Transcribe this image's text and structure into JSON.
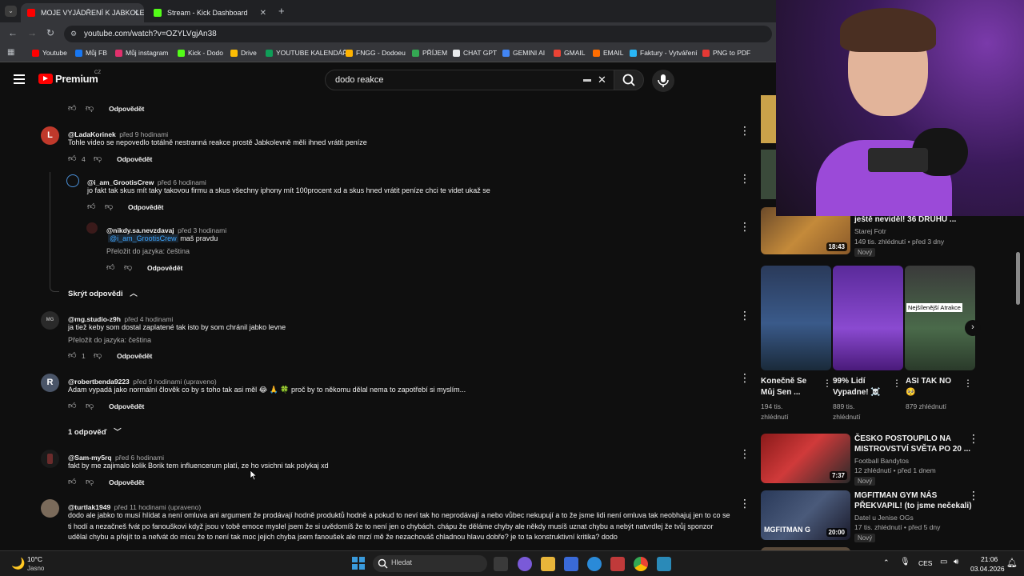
{
  "browser": {
    "tabs": [
      {
        "title": "MOJE VYJÁDŘENÍ K JABKOLEVN",
        "color": "#ff0000"
      },
      {
        "title": "Stream - Kick Dashboard",
        "color": "#53fc18"
      }
    ],
    "new_tab": "+",
    "url": "youtube.com/watch?v=OZYLVgjAn38",
    "bookmarks": [
      {
        "label": "Youtube",
        "color": "#ff0000"
      },
      {
        "label": "Můj FB",
        "color": "#1877f2"
      },
      {
        "label": "Můj instagram",
        "color": "#e1306c"
      },
      {
        "label": "Kick - Dodo",
        "color": "#53fc18"
      },
      {
        "label": "Drive",
        "color": "#fbbc04"
      },
      {
        "label": "YOUTUBE KALENDÁŘ",
        "color": "#0f9d58"
      },
      {
        "label": "FNGG - Dodoeu",
        "color": "#ffb300"
      },
      {
        "label": "PŘÍJEM",
        "color": "#34a853"
      },
      {
        "label": "CHAT GPT",
        "color": "#e8eaed"
      },
      {
        "label": "GEMINI AI",
        "color": "#4285f4"
      },
      {
        "label": "GMAIL",
        "color": "#ea4335"
      },
      {
        "label": "EMAIL",
        "color": "#ff6d00"
      },
      {
        "label": "Faktury - Vytváření",
        "color": "#29b6f6"
      },
      {
        "label": "PNG to PDF",
        "color": "#e53935"
      }
    ]
  },
  "youtube": {
    "logo": "Premium",
    "region": "CZ",
    "search_query": "dodo reakce"
  },
  "comments": [
    {
      "reply_label": "Odpovědět"
    },
    {
      "user": "@LadaKorinek",
      "time": "před 9 hodinami",
      "text": "Tohle video se nepovedlo totálně nestranná reakce prostě Jabkolevně měli ihned vrátit peníze",
      "likes": "4",
      "reply_label": "Odpovědět",
      "avatar_letter": "L",
      "avatar_color": "#c0392b"
    },
    {
      "user": "@i_am_GrootisCrew",
      "time": "před 6 hodinami",
      "text": "jo fakt tak skus mít taky takovou firmu a skus všechny iphony mít 100procent xd a skus hned vrátit peníze chci te videt ukaž se",
      "reply_label": "Odpovědět"
    },
    {
      "user": "@nikdy.sa.nevzdavaj",
      "time": "před 3 hodinami",
      "mention": "@i_am_GrootisCrew",
      "text": "maš pravdu",
      "translate": "Přeložit do jazyka: čeština",
      "reply_label": "Odpovědět"
    },
    {
      "hide_replies": "Skrýt odpovědi"
    },
    {
      "user": "@mg.studio-z9h",
      "time": "před 4 hodinami",
      "text": "ja tiež keby som dostal zaplatené tak isto by som chránil jabko levne",
      "translate": "Přeložit do jazyka: čeština",
      "likes": "1",
      "reply_label": "Odpovědět",
      "avatar_letter": "MG"
    },
    {
      "user": "@robertbenda9223",
      "time": "před 9 hodinami (upraveno)",
      "text": "Adam vypadá jako normální člověk co by s toho tak asi měl 😂 🙏 🍀  proč by to někomu dělal nema to zapotřebí si myslím...",
      "reply_label": "Odpovědět",
      "avatar_letter": "R",
      "avatar_color": "#4a5568"
    },
    {
      "replies_count": "1 odpověď"
    },
    {
      "user": "@Sam-my5rq",
      "time": "před 6 hodinami",
      "text": "fakt by me zajimalo kolik Borik tem influencerum platí, ze ho vsichni tak polykaj xd",
      "reply_label": "Odpovědět"
    },
    {
      "user": "@turtlak1949",
      "time": "před 11 hodinami (upraveno)",
      "lines": [
        "dodo ale jabko to musí hlídat a není omluva ani argument že prodávají hodně produktů hodně a pokud to neví tak ho neprodávají a nebo vůbec nekupují a to že jsme lidi není omluva tak neobhajuj  jen to co se",
        "ti hodí a nezačneš fvát po fanouškovi když jsou v tobě emoce myslel jsem že si uvědomíš že to není jen o chybách. chápu že děláme chyby ale někdy musíš uznat chybu a nebýt natvrdlej že tvůj sponzor",
        "udělal chybu a přejít to a nefvát do micu že to není tak moc jejich chyba jsem fanoušek ale mrzí mě že nezachováš chladnou hlavu dobře? je to ta konstruktivní kritika? dodo"
      ]
    }
  ],
  "sidebar": {
    "top_video": {
      "title": "ještě neviděl! 36 DRUHU ...",
      "channel": "Starej Fotr",
      "meta": "149 tis. zhlédnutí • před 3 dny",
      "badge": "Nový",
      "duration": "18:43"
    },
    "shorts": [
      {
        "title_l1": "Konečně Se",
        "title_l2": "Můj Sen ...",
        "meta_l1": "194 tis.",
        "meta_l2": "zhlédnutí"
      },
      {
        "title_l1": "99% Lidí",
        "title_l2": "Vypadne! ☠️",
        "meta_l1": "889 tis.",
        "meta_l2": "zhlédnutí"
      },
      {
        "title_l1": "ASI TAK NO",
        "title_l2": "🥺",
        "meta_l1": "879 zhlédnutí",
        "meta_l2": ""
      }
    ],
    "short_overlay": "Nejšílenější Atrakce",
    "videos": [
      {
        "title_l1": "ČESKO POSTOUPILO NA",
        "title_l2": "MISTROVSTVÍ SVĚTA PO 20 ...",
        "channel": "Football Bandytos",
        "meta": "12 zhlédnutí • před 1 dnem",
        "badge": "Nový",
        "duration": "7:37"
      },
      {
        "title_l1": "MGFITMAN GYM NÁS",
        "title_l2": "PŘEKVAPIL! (to jsme nečekali)",
        "channel": "Datel u Jenise OGs",
        "meta": "17 tis. zhlédnutí • před 5 dny",
        "badge": "Nový",
        "duration": "20:00",
        "thumb_text": "MGFITMAN G"
      }
    ]
  },
  "taskbar": {
    "weather_temp": "10°C",
    "weather_desc": "Jasno",
    "search_placeholder": "Hledat",
    "lang": "CES",
    "time": "21:06",
    "date": "03.04.2026"
  },
  "colors": {
    "accent": "#3ea6ff",
    "yt_red": "#ff0000",
    "bg": "#0f0f0f"
  }
}
